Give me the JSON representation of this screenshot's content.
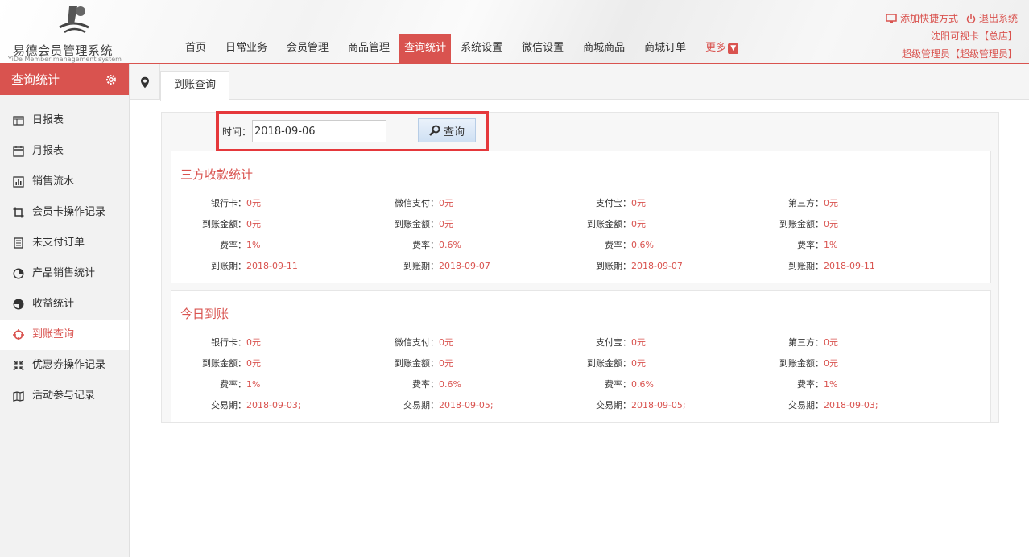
{
  "brand": {
    "title": "易德会员管理系统",
    "subtitle": "YiDe Member management system"
  },
  "nav": {
    "items": [
      "首页",
      "日常业务",
      "会员管理",
      "商品管理",
      "查询统计",
      "系统设置",
      "微信设置",
      "商城商品",
      "商城订单"
    ],
    "active_index": 4,
    "more_label": "更多"
  },
  "top_right": {
    "add_shortcut": "添加快捷方式",
    "logout": "退出系统",
    "store": "沈阳可视卡【总店】",
    "user": "超级管理员【超级管理员】"
  },
  "sidebar": {
    "title": "查询统计",
    "items": [
      {
        "label": "日报表",
        "icon": "table-icon"
      },
      {
        "label": "月报表",
        "icon": "calendar-icon"
      },
      {
        "label": "销售流水",
        "icon": "bar-chart-icon"
      },
      {
        "label": "会员卡操作记录",
        "icon": "crop-icon"
      },
      {
        "label": "未支付订单",
        "icon": "receipt-icon"
      },
      {
        "label": "产品销售统计",
        "icon": "pie-chart-icon"
      },
      {
        "label": "收益统计",
        "icon": "half-circle-icon"
      },
      {
        "label": "到账查询",
        "icon": "crosshair-icon"
      },
      {
        "label": "优惠券操作记录",
        "icon": "shrink-icon"
      },
      {
        "label": "活动参与记录",
        "icon": "book-icon"
      }
    ],
    "active_index": 7
  },
  "tab": {
    "label": "到账查询"
  },
  "search": {
    "label": "时间：",
    "value": "2018-09-06",
    "button": "查询"
  },
  "sections": [
    {
      "title": "三方收款统计",
      "rows": [
        [
          {
            "label": "银行卡：",
            "value": "0元"
          },
          {
            "label": "微信支付：",
            "value": "0元"
          },
          {
            "label": "支付宝：",
            "value": "0元"
          },
          {
            "label": "第三方：",
            "value": "0元"
          }
        ],
        [
          {
            "label": "到账金额：",
            "value": "0元"
          },
          {
            "label": "到账金额：",
            "value": "0元"
          },
          {
            "label": "到账金额：",
            "value": "0元"
          },
          {
            "label": "到账金额：",
            "value": "0元"
          }
        ],
        [
          {
            "label": "费率：",
            "value": "1%"
          },
          {
            "label": "费率：",
            "value": "0.6%"
          },
          {
            "label": "费率：",
            "value": "0.6%"
          },
          {
            "label": "费率：",
            "value": "1%"
          }
        ],
        [
          {
            "label": "到账期：",
            "value": "2018-09-11"
          },
          {
            "label": "到账期：",
            "value": "2018-09-07"
          },
          {
            "label": "到账期：",
            "value": "2018-09-07"
          },
          {
            "label": "到账期：",
            "value": "2018-09-11"
          }
        ]
      ]
    },
    {
      "title": "今日到账",
      "rows": [
        [
          {
            "label": "银行卡：",
            "value": "0元"
          },
          {
            "label": "微信支付：",
            "value": "0元"
          },
          {
            "label": "支付宝：",
            "value": "0元"
          },
          {
            "label": "第三方：",
            "value": "0元"
          }
        ],
        [
          {
            "label": "到账金额：",
            "value": "0元"
          },
          {
            "label": "到账金额：",
            "value": "0元"
          },
          {
            "label": "到账金额：",
            "value": "0元"
          },
          {
            "label": "到账金额：",
            "value": "0元"
          }
        ],
        [
          {
            "label": "费率：",
            "value": "1%"
          },
          {
            "label": "费率：",
            "value": "0.6%"
          },
          {
            "label": "费率：",
            "value": "0.6%"
          },
          {
            "label": "费率：",
            "value": "1%"
          }
        ],
        [
          {
            "label": "交易期：",
            "value": "2018-09-03;"
          },
          {
            "label": "交易期：",
            "value": "2018-09-05;"
          },
          {
            "label": "交易期：",
            "value": "2018-09-05;"
          },
          {
            "label": "交易期：",
            "value": "2018-09-03;"
          }
        ]
      ]
    }
  ],
  "colors": {
    "accent": "#d9534f",
    "highlight_border": "#e5383b"
  }
}
